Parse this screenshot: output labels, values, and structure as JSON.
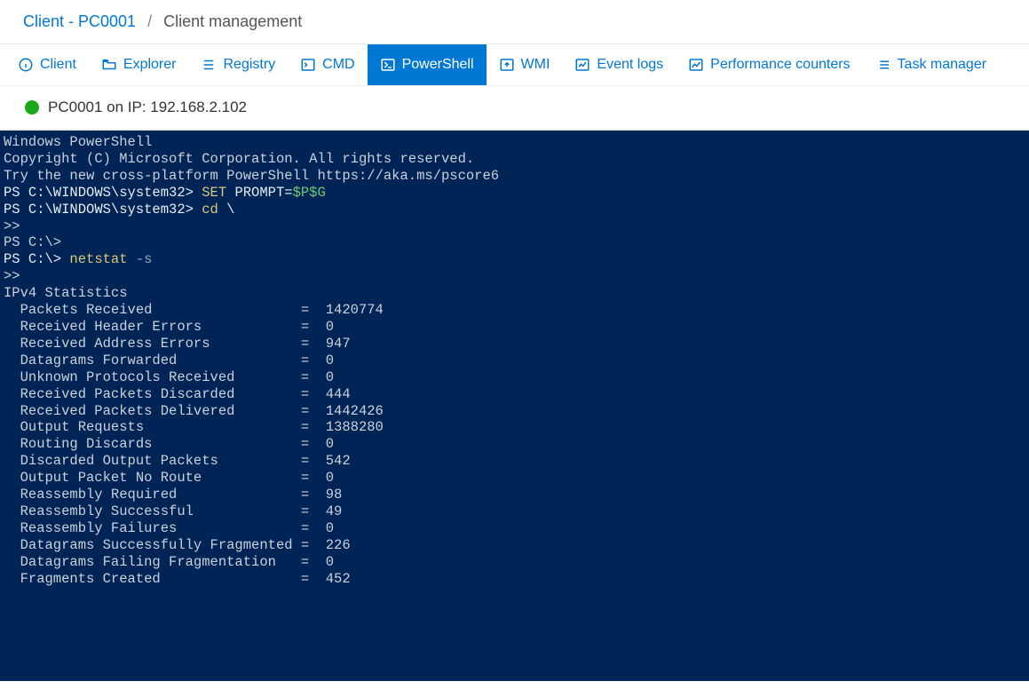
{
  "breadcrumb": {
    "link_text": "Client - PC0001",
    "separator": "/",
    "current": "Client management"
  },
  "tabs": [
    {
      "key": "client",
      "label": "Client",
      "active": false,
      "icon": "info-circle-icon"
    },
    {
      "key": "explorer",
      "label": "Explorer",
      "active": false,
      "icon": "folder-open-icon"
    },
    {
      "key": "registry",
      "label": "Registry",
      "active": false,
      "icon": "list-tree-icon"
    },
    {
      "key": "cmd",
      "label": "CMD",
      "active": false,
      "icon": "terminal-icon"
    },
    {
      "key": "ps",
      "label": "PowerShell",
      "active": true,
      "icon": "powershell-icon"
    },
    {
      "key": "wmi",
      "label": "WMI",
      "active": false,
      "icon": "upload-icon"
    },
    {
      "key": "events",
      "label": "Event logs",
      "active": false,
      "icon": "chart-error-icon"
    },
    {
      "key": "perf",
      "label": "Performance counters",
      "active": false,
      "icon": "image-alt-icon"
    },
    {
      "key": "tasks",
      "label": "Task manager",
      "active": false,
      "icon": "list-icon"
    }
  ],
  "status": {
    "dot_color": "#18a818",
    "text": "PC0001 on IP: 192.168.2.102"
  },
  "terminal": {
    "header": [
      "Windows PowerShell",
      "Copyright (C) Microsoft Corporation. All rights reserved.",
      "",
      "Try the new cross-platform PowerShell https://aka.ms/pscore6",
      ""
    ],
    "cmd1_prompt": "PS C:\\WINDOWS\\system32> ",
    "cmd1_a": "SET",
    "cmd1_b": " PROMPT=",
    "cmd1_c": "$P$G",
    "cmd2_prompt": "PS C:\\WINDOWS\\system32> ",
    "cmd2_a": "cd",
    "cmd2_b": " \\",
    "cont1": ">>",
    "prompt3": "PS C:\\>",
    "prompt4a": "PS C:\\> ",
    "cmd4_a": "netstat",
    "cmd4_b": " -s",
    "cont2": ">>",
    "blank": "",
    "stats_title": "IPv4 Statistics",
    "stats": [
      {
        "label": "Packets Received",
        "value": "1420774"
      },
      {
        "label": "Received Header Errors",
        "value": "0"
      },
      {
        "label": "Received Address Errors",
        "value": "947"
      },
      {
        "label": "Datagrams Forwarded",
        "value": "0"
      },
      {
        "label": "Unknown Protocols Received",
        "value": "0"
      },
      {
        "label": "Received Packets Discarded",
        "value": "444"
      },
      {
        "label": "Received Packets Delivered",
        "value": "1442426"
      },
      {
        "label": "Output Requests",
        "value": "1388280"
      },
      {
        "label": "Routing Discards",
        "value": "0"
      },
      {
        "label": "Discarded Output Packets",
        "value": "542"
      },
      {
        "label": "Output Packet No Route",
        "value": "0"
      },
      {
        "label": "Reassembly Required",
        "value": "98"
      },
      {
        "label": "Reassembly Successful",
        "value": "49"
      },
      {
        "label": "Reassembly Failures",
        "value": "0"
      },
      {
        "label": "Datagrams Successfully Fragmented",
        "value": "226"
      },
      {
        "label": "Datagrams Failing Fragmentation",
        "value": "0"
      },
      {
        "label": "Fragments Created",
        "value": "452"
      }
    ]
  }
}
